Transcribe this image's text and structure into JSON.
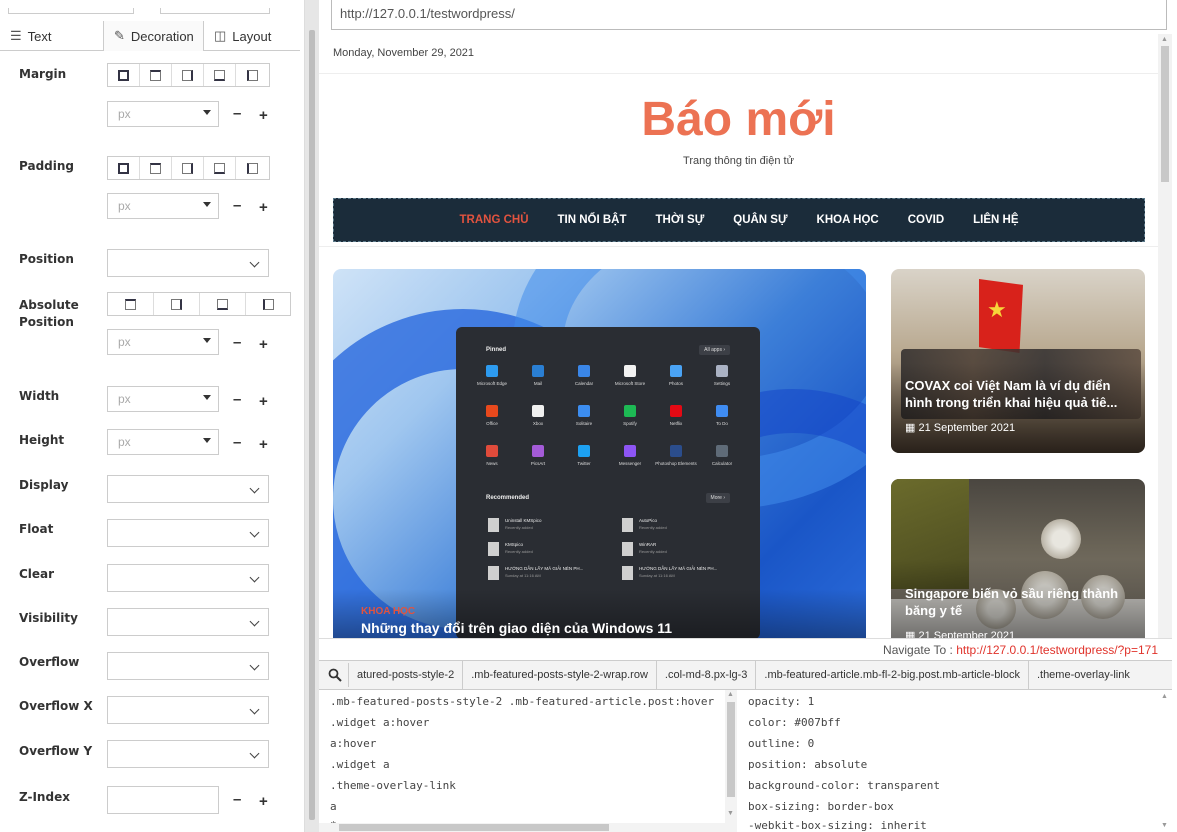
{
  "left_panel": {
    "tabs": [
      {
        "label": "Text",
        "icon": "text-align-icon"
      },
      {
        "label": "Decoration",
        "icon": "brush-icon"
      },
      {
        "label": "Layout",
        "icon": "layout-icon"
      }
    ],
    "unit_placeholder": "px",
    "labels": {
      "margin": "Margin",
      "padding": "Padding",
      "position": "Position",
      "absolute_position": "Absolute Position",
      "width": "Width",
      "height": "Height",
      "display": "Display",
      "float": "Float",
      "clear": "Clear",
      "visibility": "Visibility",
      "overflow": "Overflow",
      "overflow_x": "Overflow X",
      "overflow_y": "Overflow Y",
      "z_index": "Z-Index"
    },
    "minus": "–",
    "plus": "+"
  },
  "browser": {
    "url": "http://127.0.0.1/testwordpress/",
    "site": {
      "date": "Monday, November 29, 2021",
      "title": "Báo mới",
      "tagline": "Trang thông tin điện tử",
      "nav": [
        "TRANG CHỦ",
        "TIN NỔI BẬT",
        "THỜI SỰ",
        "QUÂN SỰ",
        "KHOA HỌC",
        "COVID",
        "LIÊN HỆ"
      ],
      "accent_color": "#ec7253",
      "featured": {
        "category": "KHOA HỌC",
        "title": "Những thay đổi trên giao diện của Windows 11"
      },
      "start_menu": {
        "pinned": "Pinned",
        "all_apps": "All apps ›",
        "apps": [
          "Microsoft Edge",
          "Mail",
          "Calendar",
          "Microsoft Store",
          "Photos",
          "Settings",
          "Office",
          "Xbox",
          "Solitaire",
          "Spotify",
          "Netflix",
          "To Do",
          "News",
          "PicsArt",
          "Twitter",
          "Messenger",
          "Photoshop Elements",
          "Calculator"
        ],
        "recommended": "Recommended",
        "more": "More ›",
        "recent": [
          {
            "title": "Uninstall KMSpico",
            "sub": "Recently added"
          },
          {
            "title": "AutoPico",
            "sub": "Recently added"
          },
          {
            "title": "KMSpico",
            "sub": "Recently added"
          },
          {
            "title": "WinRAR",
            "sub": "Recently added"
          },
          {
            "title": "HƯỚNG DẪN LẤY MÃ GIẢI NÉN PH...",
            "sub": "Sunday at 11:16 AM"
          },
          {
            "title": "HƯỚNG DẪN LẤY MÃ GIẢI NÉN PH...",
            "sub": "Sunday at 11:16 AM"
          }
        ]
      },
      "side_cards": [
        {
          "title": "COVAX coi Việt Nam là ví dụ điển hình trong triển khai hiệu quả tiê...",
          "date": "21 September 2021"
        },
        {
          "title": "Singapore biến vỏ sầu riêng thành băng y tế",
          "date": "21 September 2021"
        }
      ]
    }
  },
  "inspector": {
    "navigate_label": "Navigate To : ",
    "navigate_url": "http://127.0.0.1/testwordpress/?p=171",
    "breadcrumbs": [
      "atured-posts-style-2",
      ".mb-featured-posts-style-2-wrap.row",
      ".col-md-8.px-lg-3",
      ".mb-featured-article.mb-fl-2-big.post.mb-article-block",
      ".theme-overlay-link"
    ],
    "selectors": [
      ".mb-featured-posts-style-2 .mb-featured-article.post:hover",
      ".widget a:hover",
      "a:hover",
      ".widget a",
      ".theme-overlay-link",
      "a",
      "*"
    ],
    "properties": [
      "opacity: 1",
      "color: #007bff",
      "outline: 0",
      "position: absolute",
      "background-color: transparent",
      "box-sizing: border-box",
      "-webkit-box-sizing: inherit"
    ]
  }
}
